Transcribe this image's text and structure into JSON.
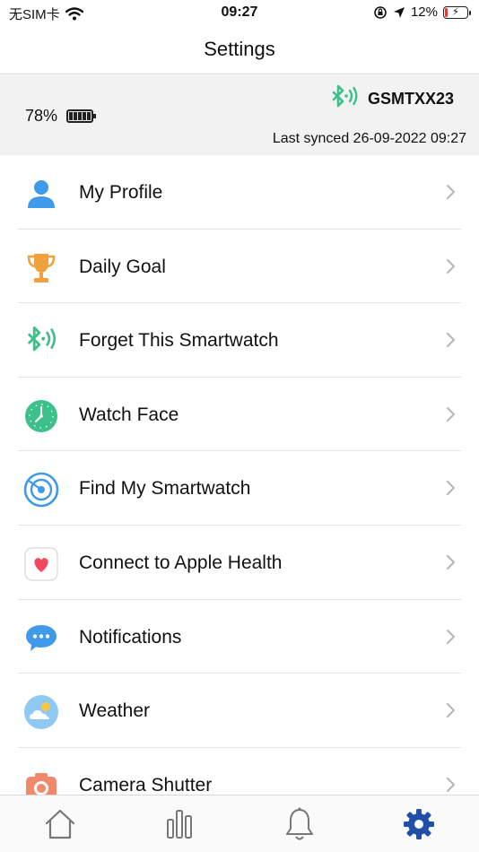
{
  "status_bar": {
    "carrier": "无SIM卡",
    "time": "09:27",
    "battery_percent": "12%",
    "battery_level": 0.12,
    "icons": [
      "wifi-icon",
      "orientation-lock-icon",
      "location-arrow-icon",
      "battery-charging-icon"
    ]
  },
  "nav": {
    "title": "Settings"
  },
  "device": {
    "battery": "78%",
    "name": "GSMTXX23",
    "last_synced": "Last synced 26-09-2022 09:27",
    "icon": "bluetooth-icon",
    "accent_color": "#3ec08b"
  },
  "menu": {
    "items": [
      {
        "label": "My Profile",
        "icon": "person-icon"
      },
      {
        "label": "Daily Goal",
        "icon": "trophy-icon"
      },
      {
        "label": "Forget This Smartwatch",
        "icon": "bluetooth-icon"
      },
      {
        "label": "Watch Face",
        "icon": "clock-icon"
      },
      {
        "label": "Find My Smartwatch",
        "icon": "radar-icon"
      },
      {
        "label": "Connect to Apple Health",
        "icon": "heart-icon"
      },
      {
        "label": "Notifications",
        "icon": "chat-bubble-icon"
      },
      {
        "label": "Weather",
        "icon": "weather-icon"
      },
      {
        "label": "Camera Shutter",
        "icon": "camera-icon"
      }
    ]
  },
  "tab_bar": {
    "tabs": [
      {
        "icon": "home-icon",
        "active": false
      },
      {
        "icon": "stats-icon",
        "active": false
      },
      {
        "icon": "bell-icon",
        "active": false
      },
      {
        "icon": "gear-icon",
        "active": true
      }
    ],
    "active_color": "#1f4fa8",
    "inactive_color": "#777777"
  }
}
